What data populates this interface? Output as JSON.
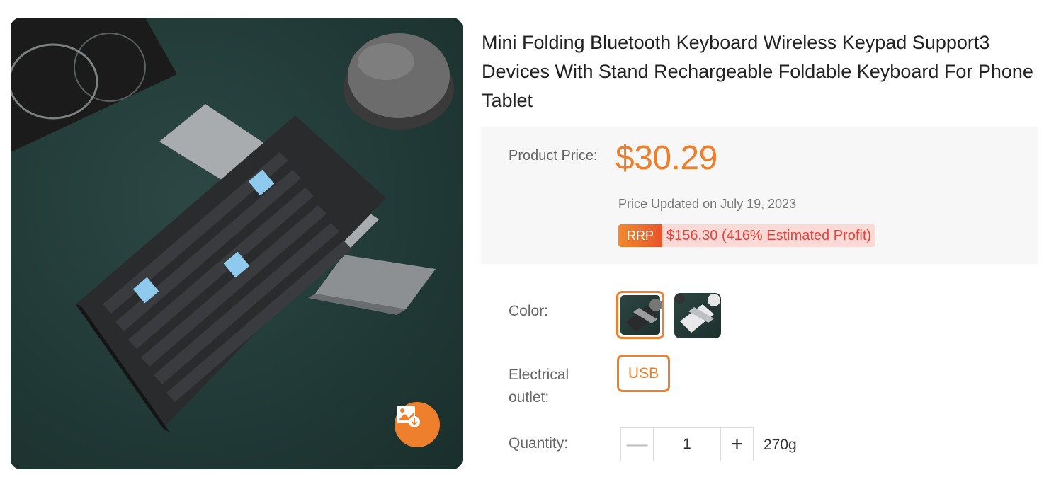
{
  "product": {
    "title": "Mini Folding Bluetooth Keyboard Wireless Keypad Support3 Devices With Stand Rechargeable Foldable Keyboard For Phone Tablet"
  },
  "price": {
    "label": "Product Price:",
    "value": "$30.29",
    "updated": "Price Updated on July 19, 2023",
    "rrp_tag": "RRP",
    "rrp_text": "$156.30 (416% Estimated Profit)"
  },
  "options": {
    "color_label": "Color:",
    "outlet_label_line1": "Electrical",
    "outlet_label_line2": "outlet:",
    "outlet_value": "USB",
    "quantity_label": "Quantity:",
    "quantity_value": "1",
    "minus": "—",
    "plus": "+",
    "weight": "270g"
  },
  "colors": {
    "accent": "#ee7f2d",
    "rrp_red": "#e8423a",
    "image_bg": "#213a37"
  },
  "icons": {
    "download": "image-download-icon"
  }
}
